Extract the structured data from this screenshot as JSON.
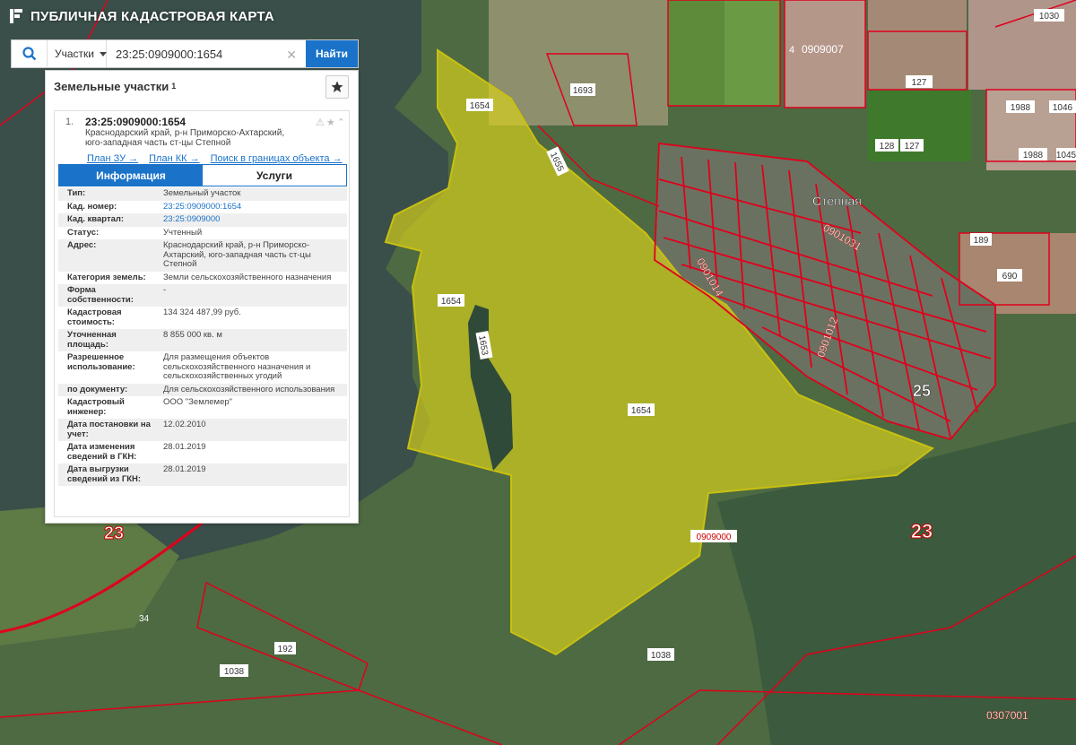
{
  "app": {
    "title": "ПУБЛИЧНАЯ КАДАСТРОВАЯ КАРТА"
  },
  "search": {
    "category": "Участки",
    "query": "23:25:0909000:1654",
    "find_label": "Найти"
  },
  "panel": {
    "title": "Земельные участки",
    "count": "1",
    "item": {
      "number": "1.",
      "cadastral": "23:25:0909000:1654",
      "addr1": "Краснодарский край, р-н Приморско-Ахтарский,",
      "addr2": "юго-западная часть ст-цы Степной",
      "links": [
        "План ЗУ →",
        "План КК →",
        "Поиск в границах объекта →"
      ]
    },
    "tabs": [
      "Информация",
      "Услуги"
    ],
    "rows": [
      {
        "label": "Тип:",
        "value": "Земельный участок"
      },
      {
        "label": "Кад. номер:",
        "value": "23:25:0909000:1654",
        "link": true
      },
      {
        "label": "Кад. квартал:",
        "value": "23:25:0909000",
        "link": true
      },
      {
        "label": "Статус:",
        "value": "Учтенный"
      },
      {
        "label": "Адрес:",
        "value": "Краснодарский край, р-н Приморско-Ахтарский, юго-западная часть ст-цы Степной"
      },
      {
        "label": "Категория земель:",
        "value": "Земли сельскохозяйственного назначения"
      },
      {
        "label": "Форма собственности:",
        "value": "-"
      },
      {
        "label": "Кадастровая стоимость:",
        "value": "134 324 487,99 руб."
      },
      {
        "label": "Уточненная площадь:",
        "value": "8 855 000 кв. м"
      },
      {
        "label": "Разрешенное использование:",
        "value": "Для размещения объектов сельскохозяйственного назначения и сельскохозяйственных угодий"
      },
      {
        "label": "по документу:",
        "value": "Для сельскохозяйственного использования"
      },
      {
        "label": "Кадастровый инженер:",
        "value": "ООО \"Землемер\""
      },
      {
        "label": "Дата постановки на учет:",
        "value": "12.02.2010"
      },
      {
        "label": "Дата изменения сведений в ГКН:",
        "value": "28.01.2019"
      },
      {
        "label": "Дата выгрузки сведений из ГКН:",
        "value": "28.01.2019"
      }
    ]
  },
  "map": {
    "labels": {
      "l1030": "1030",
      "l0909007": "0909007",
      "l4": "4",
      "l127a": "127",
      "l128": "128",
      "l127b": "127",
      "l1988a": "1988",
      "l1046": "1046",
      "l1988b": "1988",
      "l1045": "1045",
      "l1693": "1693",
      "l1654a": "1654",
      "l1655": "1655",
      "l1654b": "1654",
      "l1653": "1653",
      "l1654c": "1654",
      "stepnaya": "Степная",
      "q0901031": "0901031",
      "q0901014": "0901014",
      "q0901012": "0901012",
      "l189": "189",
      "l690": "690",
      "l25": "25",
      "l23a": "23",
      "l23b": "23",
      "l0909000": "0909000",
      "l34": "34",
      "l192": "192",
      "l1038a": "1038",
      "l1038b": "1038",
      "l0307001": "0307001"
    },
    "colors": {
      "parcel_fill": "#d8d21a",
      "boundary": "#e0001c",
      "accent": "#1a73c9"
    }
  }
}
